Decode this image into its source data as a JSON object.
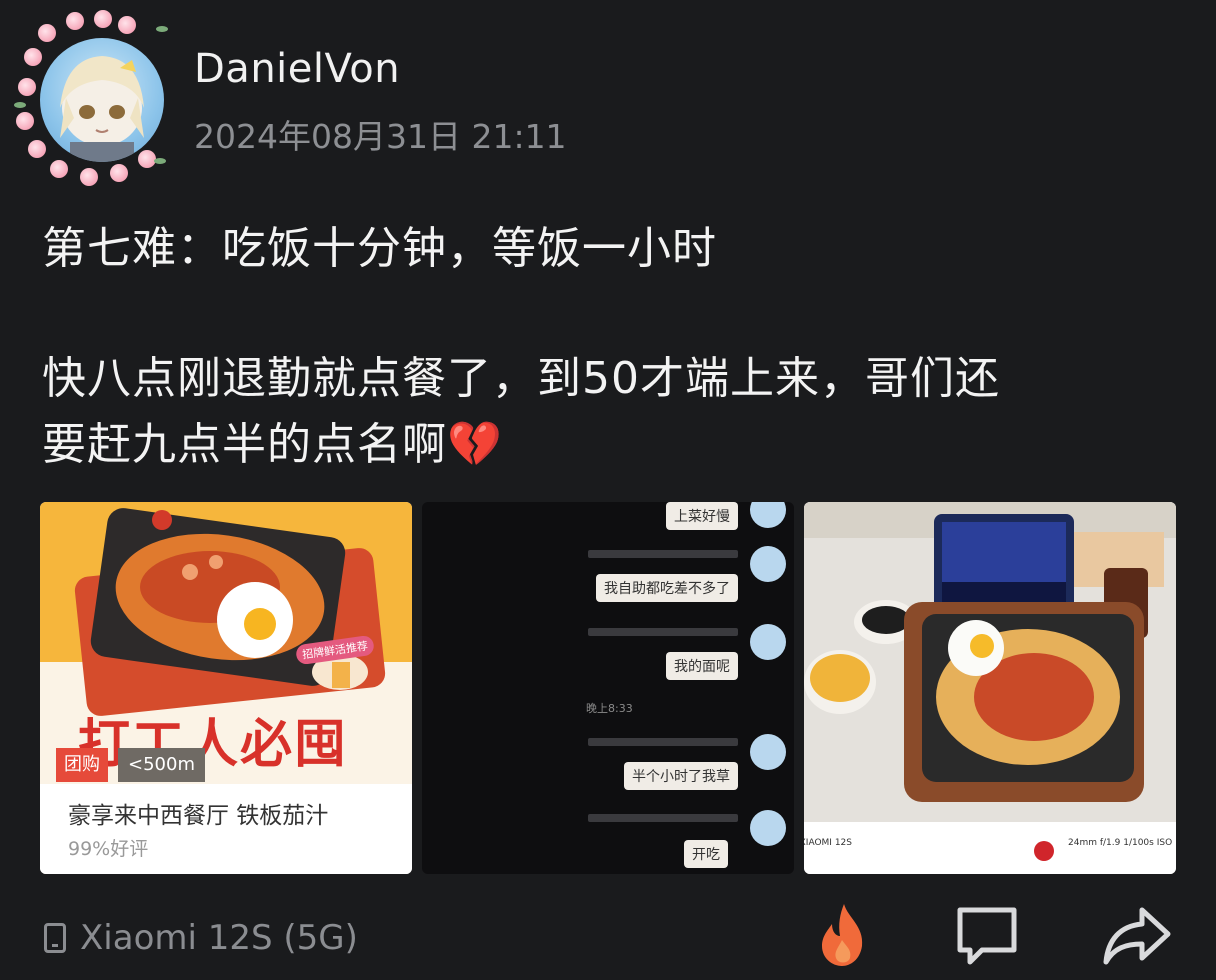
{
  "post": {
    "author": "DanielVon",
    "timestamp": "2024年08月31日 21:11",
    "text_lines": [
      "第七难：吃饭十分钟，等饭一小时",
      "快八点刚退勤就点餐了，到50才端上来，哥们还",
      "要赶九点半的点名啊💔"
    ]
  },
  "images": {
    "promo": {
      "slogan": "打工人必囤",
      "tag_group": "团购",
      "tag_distance": "<500m",
      "shop_name": "豪享来中西餐厅 铁板茄汁",
      "rating": "99%好评",
      "badge": "招牌鲜活推荐"
    },
    "chat": {
      "messages": [
        "上菜好慢",
        "我自助都吃差不多了",
        "我的面呢",
        "半个小时了我草",
        "开吃"
      ],
      "time_divider": "晚上8:33"
    },
    "photo": {
      "camera_model": "XIAOMI 12S",
      "exif": "24mm f/1.9 1/100s ISO"
    }
  },
  "footer": {
    "device": "Xiaomi 12S (5G)",
    "actions": [
      "fire-icon",
      "comment-icon",
      "share-icon"
    ]
  },
  "colors": {
    "background": "#1a1b1d",
    "fire": "#f06a3a",
    "muted": "#8d8f93"
  }
}
